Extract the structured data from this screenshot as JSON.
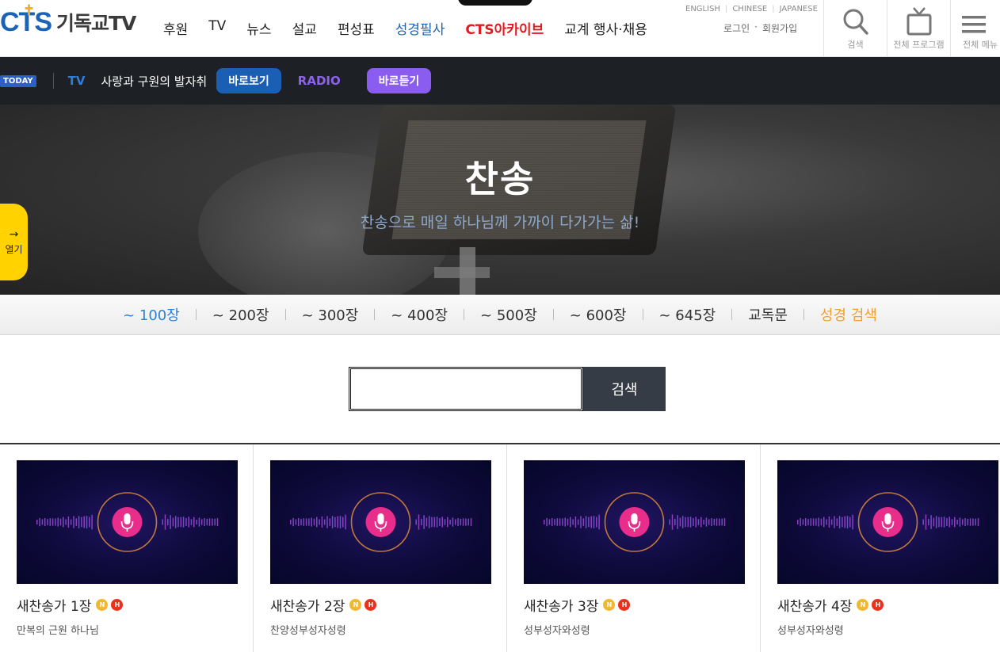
{
  "header": {
    "logo_mark": "CTS",
    "logo_text": "기독교TV",
    "nav": [
      "후원",
      "TV",
      "뉴스",
      "설교",
      "편성표",
      "성경필사",
      "CTS아카이브",
      "교계 행사·채용"
    ],
    "lang": [
      "ENGLISH",
      "CHINESE",
      "JAPANESE"
    ],
    "login": "로그인",
    "signup": "회원가입",
    "util_search": "검색",
    "util_programs": "전체 프로그램",
    "util_menu": "전체 메뉴"
  },
  "today": {
    "badge": "TODAY",
    "tv_tag": "TV",
    "program": "사랑과 구원의 발자취",
    "watch_button": "바로보기",
    "radio_tag": "RADIO",
    "listen_button": "바로듣기"
  },
  "hero": {
    "title": "찬송",
    "subtitle": "찬송으로 매일 하나님께 가까이 다가가는 삶!",
    "open_arrow": "→",
    "open_label": "열기"
  },
  "tabs": [
    "~ 100장",
    "~ 200장",
    "~ 300장",
    "~ 400장",
    "~ 500장",
    "~ 600장",
    "~ 645장",
    "교독문",
    "성경 검색"
  ],
  "search": {
    "value": "",
    "button": "검색"
  },
  "cards": [
    {
      "title": "새찬송가 1장",
      "subtitle": "만복의 근원 하나님",
      "badge_n": "N",
      "badge_h": "H"
    },
    {
      "title": "새찬송가 2장",
      "subtitle": "찬양성부성자성령",
      "badge_n": "N",
      "badge_h": "H"
    },
    {
      "title": "새찬송가 3장",
      "subtitle": "성부성자와성령",
      "badge_n": "N",
      "badge_h": "H"
    },
    {
      "title": "새찬송가 4장",
      "subtitle": "성부성자와성령",
      "badge_n": "N",
      "badge_h": "H"
    }
  ],
  "colors": {
    "brand_blue": "#1a63b5",
    "archive_red": "#e3191f",
    "active_tab": "#2f7fd9",
    "bible_search": "#f0a030",
    "radio_purple": "#8b5cf0",
    "open_tab_yellow": "#ffd200"
  }
}
